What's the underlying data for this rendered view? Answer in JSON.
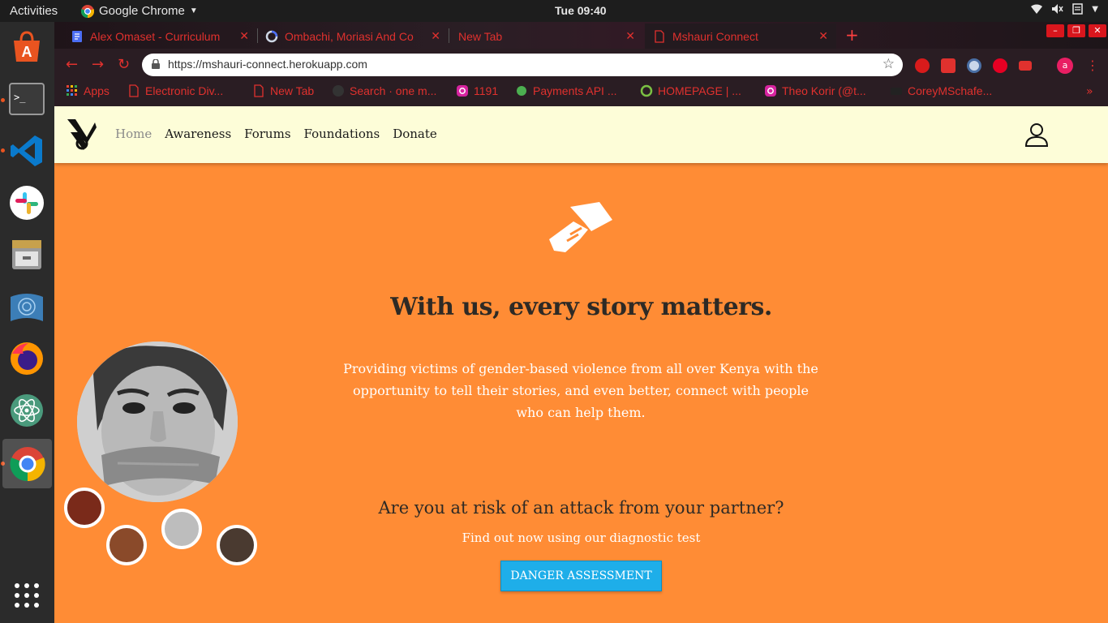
{
  "topbar": {
    "activities": "Activities",
    "app_name": "Google Chrome",
    "clock": "Tue 09:40"
  },
  "tabs": [
    {
      "title": "Alex Omaset - Curriculum",
      "favicon": "docs-icon"
    },
    {
      "title": "Ombachi, Moriasi And Co",
      "favicon": "loading-icon"
    },
    {
      "title": "New Tab",
      "favicon": ""
    },
    {
      "title": "Mshauri Connect",
      "favicon": "page-icon"
    }
  ],
  "omnibox": {
    "url": "https://mshauri-connect.herokuapp.com"
  },
  "bookmarks": [
    {
      "label": "Apps"
    },
    {
      "label": "Electronic Div..."
    },
    {
      "label": "New Tab"
    },
    {
      "label": "Search · one m..."
    },
    {
      "label": "1191"
    },
    {
      "label": "Payments API ..."
    },
    {
      "label": "HOMEPAGE | ..."
    },
    {
      "label": "Theo Korir (@t..."
    },
    {
      "label": "CoreyMSchafe..."
    }
  ],
  "site": {
    "nav": [
      "Home",
      "Awareness",
      "Forums",
      "Foundations",
      "Donate"
    ],
    "headline": "With us, every story matters.",
    "subtext": "Providing victims of gender-based violence from all over Kenya with the opportunity to tell their stories, and even better, connect with people who can help them.",
    "question": "Are you at risk of an attack from your partner?",
    "findout": "Find out now using our diagnostic test",
    "button": "DANGER ASSESSMENT"
  },
  "colors": {
    "page_bg": "#ff8c35",
    "navbar_bg": "#fdfdd8",
    "button_bg": "#1eaee9",
    "chrome_accent": "#e0312e"
  }
}
